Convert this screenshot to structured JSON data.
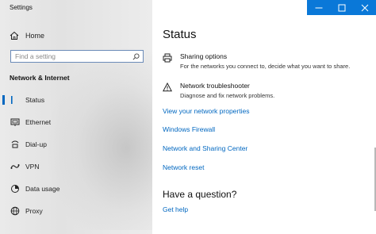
{
  "window": {
    "title": "Settings",
    "buttons": {
      "minimize": "minimize-icon",
      "maximize": "maximize-icon",
      "close": "close-icon"
    },
    "accent_color": "#0a78d8"
  },
  "sidebar": {
    "home_label": "Home",
    "search_placeholder": "Find a setting",
    "section_label": "Network & Internet",
    "items": [
      {
        "label": "Status",
        "icon": "status-icon",
        "active": true
      },
      {
        "label": "Ethernet",
        "icon": "ethernet-icon"
      },
      {
        "label": "Dial-up",
        "icon": "dialup-icon"
      },
      {
        "label": "VPN",
        "icon": "vpn-icon"
      },
      {
        "label": "Data usage",
        "icon": "data-usage-icon"
      },
      {
        "label": "Proxy",
        "icon": "globe-icon"
      }
    ]
  },
  "main": {
    "title": "Status",
    "items": [
      {
        "title": "Sharing options",
        "description": "For the networks you connect to, decide what you want to share.",
        "icon": "printer-icon"
      },
      {
        "title": "Network troubleshooter",
        "description": "Diagnose and fix network problems.",
        "icon": "warning-icon"
      }
    ],
    "links": [
      "View your network properties",
      "Windows Firewall",
      "Network and Sharing Center",
      "Network reset"
    ],
    "question_heading": "Have a question?",
    "help_link": "Get help",
    "link_color": "#0067c0"
  }
}
